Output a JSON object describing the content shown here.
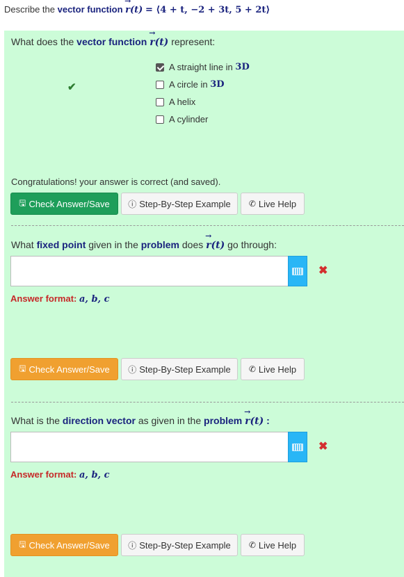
{
  "header": {
    "prefix": "Describe the",
    "bold": "vector function",
    "vec_letter": "r",
    "arg": "(t)",
    "rhs": "= ⟨4 + t,  −2 + 3t,  5 + 2t⟩"
  },
  "q1": {
    "prefix": "What does the",
    "bold": "vector function",
    "vec_letter": "r",
    "arg": "(t)",
    "suffix": "represent:",
    "options": [
      {
        "label": "A straight line in",
        "math": "3D",
        "checked": true
      },
      {
        "label": "A circle in",
        "math": "3D",
        "checked": false
      },
      {
        "label": "A helix",
        "math": "",
        "checked": false
      },
      {
        "label": "A cylinder",
        "math": "",
        "checked": false
      }
    ],
    "status": "Congratulations! your answer is correct (and saved).",
    "check_label": "Check Answer/Save",
    "step_label": "Step-By-Step Example",
    "live_label": "Live Help"
  },
  "q2": {
    "prefix": "What",
    "bold1": "fixed point",
    "mid": "given in the",
    "bold2": "problem",
    "mid2": "does",
    "vec_letter": "r",
    "arg": "(t)",
    "suffix": "go through:",
    "input_value": "",
    "format_label": "Answer format:",
    "format_math": "a, b, c",
    "check_label": "Check Answer/Save",
    "step_label": "Step-By-Step Example",
    "live_label": "Live Help"
  },
  "q3": {
    "prefix": "What is the",
    "bold1": "direction vector",
    "mid": "as given in the",
    "bold2": "problem",
    "vec_letter": "r",
    "arg": "(t)",
    "suffix": ":",
    "input_value": "",
    "format_label": "Answer format:",
    "format_math": "a, b, c",
    "check_label": "Check Answer/Save",
    "step_label": "Step-By-Step Example",
    "live_label": "Live Help"
  },
  "icons": {
    "correct": "check-icon",
    "wrong": "x-icon",
    "save": "floppy-icon",
    "info": "info-circle-icon",
    "phone": "phone-icon",
    "keyboard": "keyboard-icon"
  },
  "colors": {
    "panel": "#ccfcd8",
    "green_button": "#1e9e5a",
    "orange_button": "#f0a030",
    "keyboard_button": "#29b6f6",
    "error": "#d32f2f",
    "math": "#1a237e"
  }
}
